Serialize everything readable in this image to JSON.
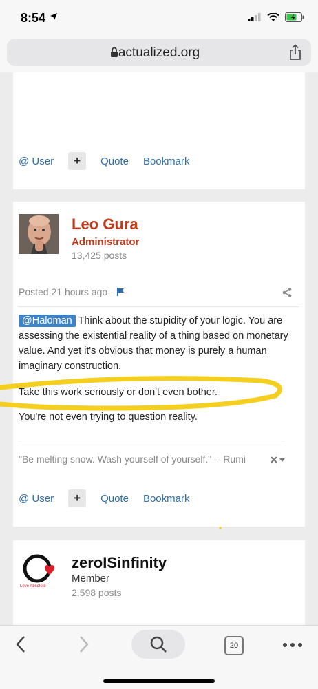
{
  "status_bar": {
    "time": "8:54"
  },
  "browser": {
    "url": "actualized.org",
    "tab_count": "20"
  },
  "post_top": {
    "actions": {
      "user": "@ User",
      "plus": "+",
      "quote": "Quote",
      "bookmark": "Bookmark"
    }
  },
  "post_leo": {
    "author": "Leo Gura",
    "role": "Administrator",
    "post_count": "13,425 posts",
    "posted": "Posted 21 hours ago",
    "separator": "·",
    "mention": "@Haloman",
    "para1": " Think about the stupidity of your logic. You are assessing the existential reality of a thing based on monetary value. And yet it's obvious that money is purely a human imaginary construction.",
    "para2": "Take this work seriously or don't even bother.",
    "para3": "You're not even trying to question reality.",
    "signature": "\"Be melting snow. Wash yourself of yourself.\" -- Rumi",
    "actions": {
      "user": "@ User",
      "plus": "+",
      "quote": "Quote",
      "bookmark": "Bookmark"
    }
  },
  "post_zero": {
    "author": "zeroISinfinity",
    "role": "Member",
    "post_count": "2,598 posts",
    "logo_text": "Love Absolute"
  },
  "colors": {
    "accent_orange": "#c0391b",
    "link_blue": "#2f6fb0",
    "highlight_yellow": "#f4cf1f"
  }
}
